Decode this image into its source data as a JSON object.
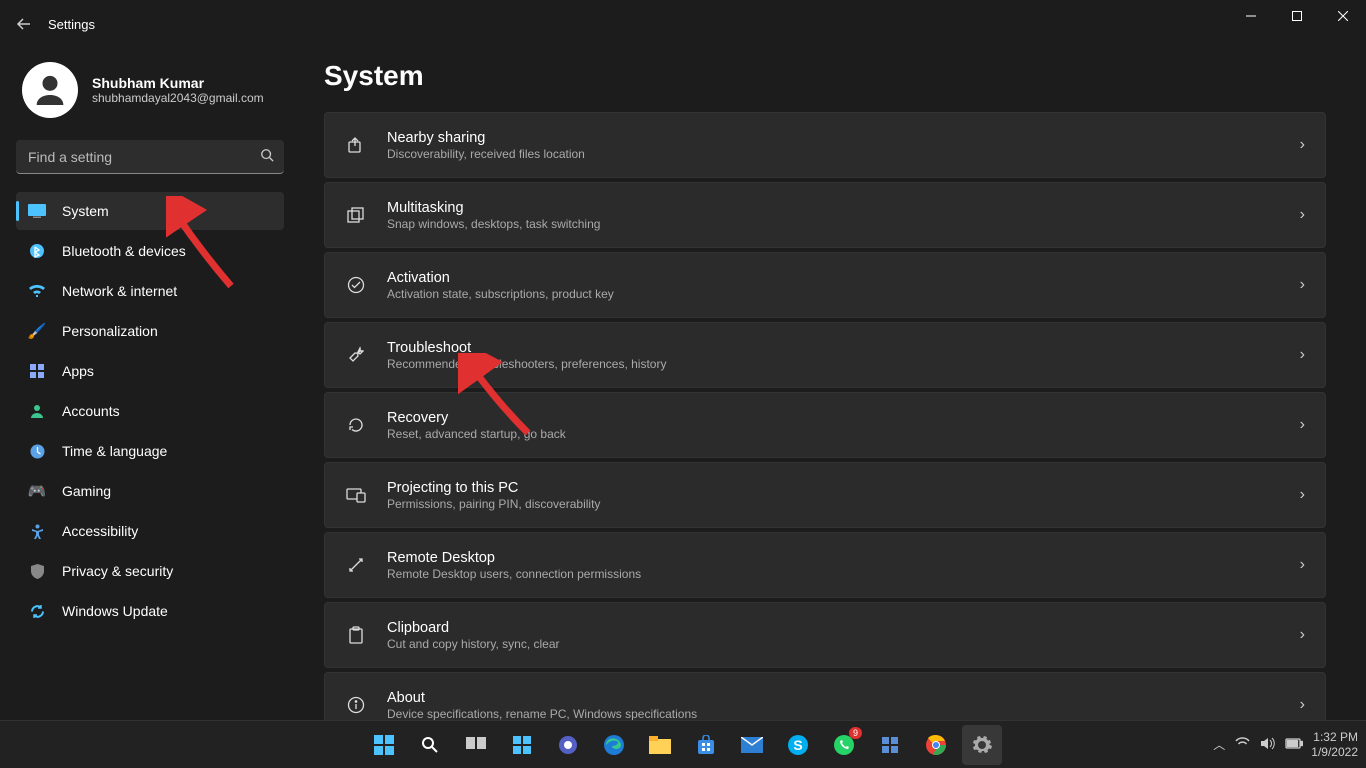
{
  "window": {
    "title": "Settings"
  },
  "profile": {
    "name": "Shubham Kumar",
    "email": "shubhamdayal2043@gmail.com"
  },
  "search": {
    "placeholder": "Find a setting"
  },
  "nav": [
    {
      "label": "System",
      "icon": "🖥️",
      "active": true,
      "color": "#4cc2ff"
    },
    {
      "label": "Bluetooth & devices",
      "icon": "",
      "color": "#4cc2ff"
    },
    {
      "label": "Network & internet",
      "icon": "",
      "color": "#4cc2ff"
    },
    {
      "label": "Personalization",
      "icon": "🖌️",
      "color": "#e48f6a"
    },
    {
      "label": "Apps",
      "icon": "▦",
      "color": "#8aa9f9"
    },
    {
      "label": "Accounts",
      "icon": "👤",
      "color": "#3cc58f"
    },
    {
      "label": "Time & language",
      "icon": "🕒",
      "color": "#5aa1e6"
    },
    {
      "label": "Gaming",
      "icon": "🎮",
      "color": "#888"
    },
    {
      "label": "Accessibility",
      "icon": "✋",
      "color": "#5aa1e6"
    },
    {
      "label": "Privacy & security",
      "icon": "🛡️",
      "color": "#888"
    },
    {
      "label": "Windows Update",
      "icon": "🔄",
      "color": "#4cc2ff"
    }
  ],
  "page": {
    "title": "System"
  },
  "cards": [
    {
      "title": "Nearby sharing",
      "desc": "Discoverability, received files location",
      "icon": "share"
    },
    {
      "title": "Multitasking",
      "desc": "Snap windows, desktops, task switching",
      "icon": "multitask"
    },
    {
      "title": "Activation",
      "desc": "Activation state, subscriptions, product key",
      "icon": "check"
    },
    {
      "title": "Troubleshoot",
      "desc": "Recommended troubleshooters, preferences, history",
      "icon": "wrench"
    },
    {
      "title": "Recovery",
      "desc": "Reset, advanced startup, go back",
      "icon": "recovery"
    },
    {
      "title": "Projecting to this PC",
      "desc": "Permissions, pairing PIN, discoverability",
      "icon": "project"
    },
    {
      "title": "Remote Desktop",
      "desc": "Remote Desktop users, connection permissions",
      "icon": "remote"
    },
    {
      "title": "Clipboard",
      "desc": "Cut and copy history, sync, clear",
      "icon": "clipboard"
    },
    {
      "title": "About",
      "desc": "Device specifications, rename PC, Windows specifications",
      "icon": "info"
    }
  ],
  "taskbar": {
    "time": "1:32 PM",
    "date": "1/9/2022",
    "whatsapp_badge": "9"
  }
}
